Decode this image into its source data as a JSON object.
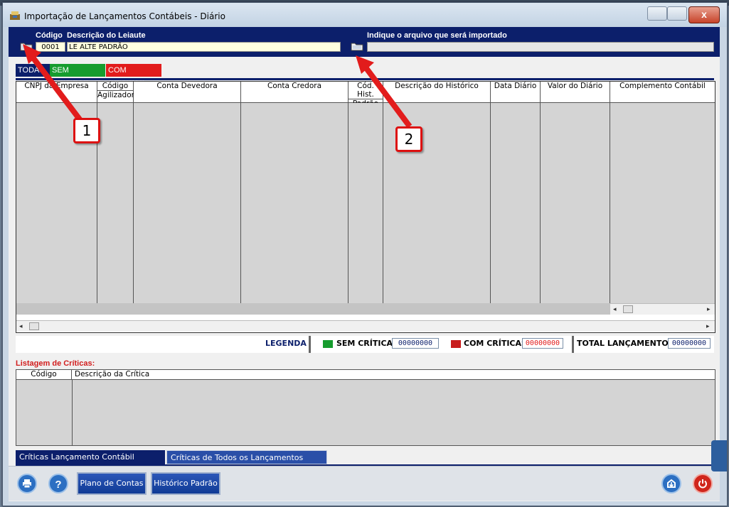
{
  "window": {
    "title": "Importação de Lançamentos Contábeis  -  Diário",
    "close_label": "x"
  },
  "header": {
    "code_label": "Código",
    "desc_label": "Descrição do Leiaute",
    "code_value": "0001",
    "desc_value": "LE ALTE PADRÃO",
    "file_label": "Indique o arquivo que será importado",
    "file_value": ""
  },
  "tabs": [
    {
      "label": "TODAS",
      "bg": "#0c1f6b",
      "fg": "#ffffff"
    },
    {
      "label": "SEM CRÍTICAS",
      "bg": "#169c2e",
      "fg": "#ffffff"
    },
    {
      "label": "COM CRÍTICAS",
      "bg": "#e21c1c",
      "fg": "#ffffff"
    }
  ],
  "grid": {
    "columns": [
      {
        "label": "CNPJ da Empresa",
        "label2": ""
      },
      {
        "label": "Código",
        "label2": "Agilizador"
      },
      {
        "label": "Conta Devedora",
        "label2": ""
      },
      {
        "label": "Conta Credora",
        "label2": ""
      },
      {
        "label": "Cód. Hist.",
        "label2": "Padrão"
      },
      {
        "label": "Descrição do Histórico",
        "label2": ""
      },
      {
        "label": "Data Diário",
        "label2": ""
      },
      {
        "label": "Valor do Diário",
        "label2": ""
      },
      {
        "label": "Complemento Contábil",
        "label2": ""
      }
    ]
  },
  "legend": {
    "title": "LEGENDA",
    "sem_label": "SEM CRÍTICAS",
    "sem_count": "00000000",
    "com_label": "COM CRÍTICAS",
    "com_count": "00000000",
    "total_label": "TOTAL LANÇAMENTOS",
    "total_count": "00000000",
    "green": "#169c2e",
    "red": "#c81c1c"
  },
  "criticas": {
    "title": "Listagem de Críticas:",
    "col_codigo": "Código",
    "col_descricao": "Descrição da Crítica"
  },
  "bottom_tabs": [
    "Críticas Lançamento Contábil Selecionado",
    "Críticas de Todos os Lançamentos Contábeis"
  ],
  "footer": {
    "plano_label": "Plano de Contas",
    "historico_label": "Histórico Padrão"
  },
  "annotations": {
    "marker1": "1",
    "marker2": "2"
  },
  "colors": {
    "header_bg": "#0c1f6b",
    "accent_red": "#d21d1d"
  }
}
